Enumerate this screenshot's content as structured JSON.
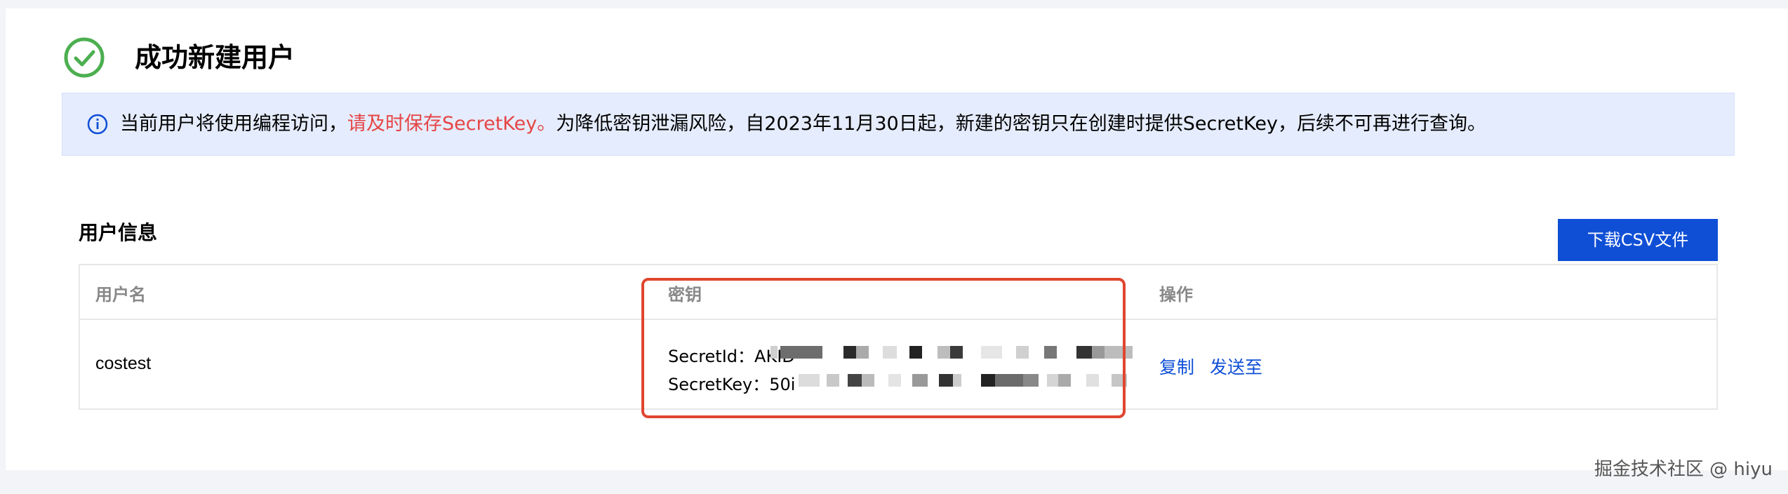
{
  "header": {
    "title": "成功新建用户",
    "status": "success"
  },
  "notice": {
    "prefix": "当前用户将使用编程访问，",
    "highlight": "请及时保存SecretKey。",
    "suffix": "为降低密钥泄漏风险，自2023年11月30日起，新建的密钥只在创建时提供SecretKey，后续不可再进行查询。"
  },
  "user_info": {
    "section_title": "用户信息",
    "download_button": "下载CSV文件",
    "columns": {
      "username": "用户名",
      "key": "密钥",
      "actions": "操作"
    },
    "rows": [
      {
        "username": "costest",
        "secret_id_label": "SecretId：",
        "secret_id_prefix": "AKID",
        "secret_key_label": "SecretKey：",
        "secret_key_prefix": "50i",
        "action_copy": "复制",
        "action_send": "发送至"
      }
    ]
  },
  "colors": {
    "accent": "#0f4fd6",
    "success": "#4caf50",
    "warning_text": "#e54545",
    "notice_bg": "#e5ecfd",
    "highlight_border": "#e0452e"
  },
  "watermark": "掘金技术社区 @ hiyu"
}
